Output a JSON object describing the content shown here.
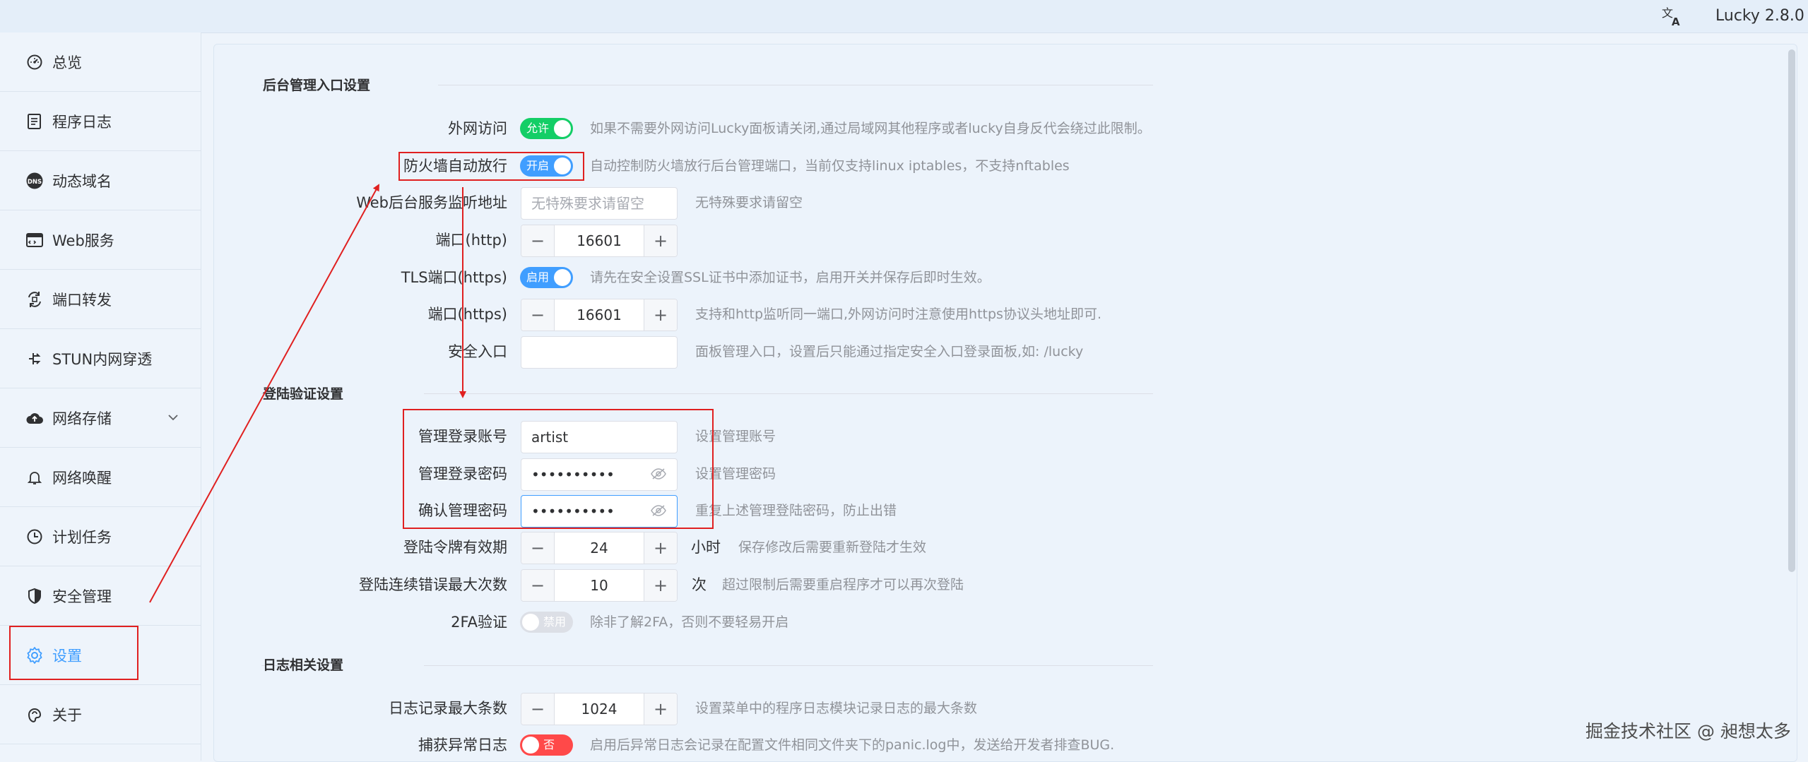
{
  "header": {
    "version": "Lucky 2.8.0",
    "lang_icon": "translate-icon"
  },
  "sidebar": {
    "items": [
      {
        "label": "总览",
        "icon": "dashboard-icon"
      },
      {
        "label": "程序日志",
        "icon": "log-icon"
      },
      {
        "label": "动态域名",
        "icon": "dns-icon"
      },
      {
        "label": "Web服务",
        "icon": "web-icon"
      },
      {
        "label": "端口转发",
        "icon": "port-forward-icon"
      },
      {
        "label": "STUN内网穿透",
        "icon": "stun-icon"
      },
      {
        "label": "网络存储",
        "icon": "cloud-storage-icon"
      },
      {
        "label": "网络唤醒",
        "icon": "bell-icon"
      },
      {
        "label": "计划任务",
        "icon": "clock-icon"
      },
      {
        "label": "安全管理",
        "icon": "shield-icon"
      },
      {
        "label": "设置",
        "icon": "gear-icon"
      },
      {
        "label": "关于",
        "icon": "about-icon"
      }
    ],
    "active": "设置"
  },
  "settings": {
    "admin": {
      "title": "后台管理入口设置",
      "external_access": {
        "label": "外网访问",
        "switch": "允许",
        "hint": "如果不需要外网访问Lucky面板请关闭,通过局域网其他程序或者lucky自身反代会绕过此限制。"
      },
      "firewall": {
        "label": "防火墙自动放行",
        "switch": "开启",
        "hint": "自动控制防火墙放行后台管理端口，当前仅支持linux iptables，不支持nftables"
      },
      "listen_addr": {
        "label": "Web后台服务监听地址",
        "placeholder": "无特殊要求请留空",
        "hint": "无特殊要求请留空"
      },
      "http_port": {
        "label": "端口(http)",
        "value": "16601"
      },
      "tls_port": {
        "label": "TLS端口(https)",
        "switch": "启用",
        "hint": "请先在安全设置SSL证书中添加证书，启用开关并保存后即时生效。"
      },
      "https_port": {
        "label": "端口(https)",
        "value": "16601",
        "hint": "支持和http监听同一端口,外网访问时注意使用https协议头地址即可."
      },
      "safe_entry": {
        "label": "安全入口",
        "value": "",
        "hint": "面板管理入口，设置后只能通过指定安全入口登录面板,如: /lucky"
      }
    },
    "login": {
      "title": "登陆验证设置",
      "account": {
        "label": "管理登录账号",
        "value": "artist",
        "hint": "设置管理账号"
      },
      "password": {
        "label": "管理登录密码",
        "value": "••••••••••",
        "hint": "设置管理密码"
      },
      "confirm": {
        "label": "确认管理密码",
        "value": "••••••••••",
        "hint": "重复上述管理登陆密码，防止出错"
      },
      "token_ttl": {
        "label": "登陆令牌有效期",
        "value": "24",
        "unit": "小时",
        "hint": "保存修改后需要重新登陆才生效"
      },
      "max_errors": {
        "label": "登陆连续错误最大次数",
        "value": "10",
        "unit": "次",
        "hint": "超过限制后需要重启程序才可以再次登陆"
      },
      "twofa": {
        "label": "2FA验证",
        "switch": "禁用",
        "hint": "除非了解2FA，否则不要轻易开启"
      }
    },
    "log": {
      "title": "日志相关设置",
      "max_entries": {
        "label": "日志记录最大条数",
        "value": "1024",
        "hint": "设置菜单中的程序日志模块记录日志的最大条数"
      },
      "panic_log": {
        "label": "捕获异常日志",
        "switch": "否",
        "hint": "启用后异常日志会记录在配置文件相同文件夹下的panic.log中，发送给开发者排查BUG."
      }
    }
  },
  "watermark": "掘金技术社区 @ 昶想太多",
  "colors": {
    "accent": "#409eff",
    "annotation": "#e02020",
    "switch_green": "#13ce66",
    "switch_red": "#ff4949"
  }
}
